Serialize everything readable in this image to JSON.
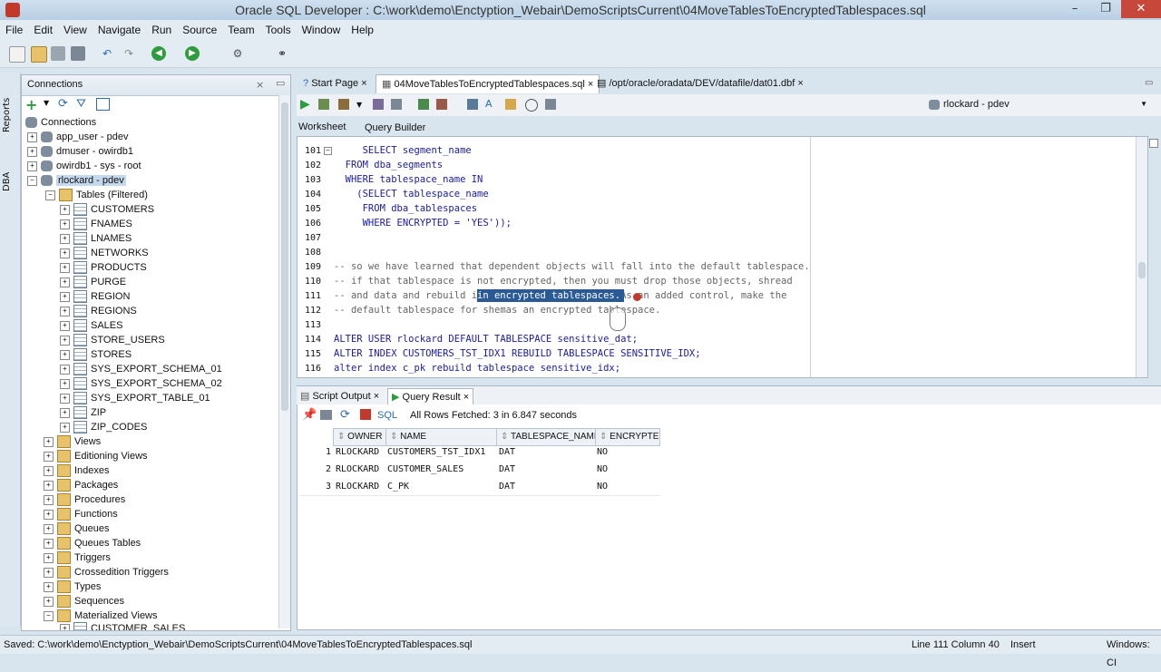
{
  "window": {
    "title": "Oracle SQL Developer : C:\\work\\demo\\Enctyption_Webair\\DemoScriptsCurrent\\04MoveTablesToEncryptedTablespaces.sql"
  },
  "menu": [
    "File",
    "Edit",
    "View",
    "Navigate",
    "Run",
    "Source",
    "Team",
    "Tools",
    "Window",
    "Help"
  ],
  "side_tabs": [
    "Reports",
    "DBA"
  ],
  "connections": {
    "title": "Connections",
    "root": "Connections",
    "items": [
      "app_user - pdev",
      "dmuser - owirdb1",
      "owirdb1 - sys - root",
      "rlockard - pdev"
    ],
    "tables_node": "Tables (Filtered)",
    "tables": [
      "CUSTOMERS",
      "FNAMES",
      "LNAMES",
      "NETWORKS",
      "PRODUCTS",
      "PURGE",
      "REGION",
      "REGIONS",
      "SALES",
      "STORE_USERS",
      "STORES",
      "SYS_EXPORT_SCHEMA_01",
      "SYS_EXPORT_SCHEMA_02",
      "SYS_EXPORT_TABLE_01",
      "ZIP",
      "ZIP_CODES"
    ],
    "folders": [
      "Views",
      "Editioning Views",
      "Indexes",
      "Packages",
      "Procedures",
      "Functions",
      "Queues",
      "Queues Tables",
      "Triggers",
      "Crossedition Triggers",
      "Types",
      "Sequences",
      "Materialized Views"
    ],
    "last_item": "CUSTOMER_SALES"
  },
  "doc_tabs": [
    "Start Page",
    "04MoveTablesToEncryptedTablespaces.sql",
    "/opt/oracle/oradata/DEV/datafile/dat01.dbf"
  ],
  "connection_selector": "rlockard - pdev",
  "sub_tabs": [
    "Worksheet",
    "Query Builder"
  ],
  "editor": {
    "lines": [
      {
        "n": "101",
        "text": "     SELECT segment_name"
      },
      {
        "n": "102",
        "text": "  FROM dba_segments"
      },
      {
        "n": "103",
        "text": "  WHERE tablespace_name IN"
      },
      {
        "n": "104",
        "text": "    (SELECT tablespace_name"
      },
      {
        "n": "105",
        "text": "     FROM dba_tablespaces"
      },
      {
        "n": "106",
        "text": "     WHERE ENCRYPTED = 'YES'));"
      },
      {
        "n": "107",
        "text": ""
      },
      {
        "n": "108",
        "text": ""
      },
      {
        "n": "109",
        "text": "-- so we have learned that dependent objects will fall into the default tablespace."
      },
      {
        "n": "110",
        "text": "-- if that tablespace is not encrypted, then you must drop those objects, shread"
      },
      {
        "n": "111",
        "text": "-- and data and rebuild in encrypted tablespaces. As an added control, make the"
      },
      {
        "n": "112",
        "text": "-- default tablespace for shemas an encrypted tablespace."
      },
      {
        "n": "113",
        "text": ""
      },
      {
        "n": "114",
        "text": "ALTER USER rlockard DEFAULT TABLESPACE sensitive_dat;"
      },
      {
        "n": "115",
        "text": "ALTER INDEX CUSTOMERS_TST_IDX1 REBUILD TABLESPACE SENSITIVE_IDX;"
      },
      {
        "n": "116",
        "text": "alter index c_pk rebuild tablespace sensitive_idx;"
      }
    ],
    "selected_text": "in encrypted tablespaces."
  },
  "result_tabs": [
    "Script Output",
    "Query Result"
  ],
  "result_toolbar": {
    "sql_label": "SQL",
    "status": "All Rows Fetched: 3 in 6.847 seconds"
  },
  "result_grid": {
    "columns": [
      "OWNER",
      "NAME",
      "TABLESPACE_NAME",
      "ENCRYPTED"
    ],
    "rows": [
      {
        "n": "1",
        "owner": "RLOCKARD",
        "name": "CUSTOMERS_TST_IDX1",
        "ts": "DAT",
        "enc": "NO"
      },
      {
        "n": "2",
        "owner": "RLOCKARD",
        "name": "CUSTOMER_SALES",
        "ts": "DAT",
        "enc": "NO"
      },
      {
        "n": "3",
        "owner": "RLOCKARD",
        "name": "C_PK",
        "ts": "DAT",
        "enc": "NO"
      }
    ]
  },
  "status": {
    "saved": "Saved: C:\\work\\demo\\Enctyption_Webair\\DemoScriptsCurrent\\04MoveTablesToEncryptedTablespaces.sql",
    "position": "Line 111 Column 40",
    "mode": "Insert",
    "platform": "Windows: CI"
  }
}
